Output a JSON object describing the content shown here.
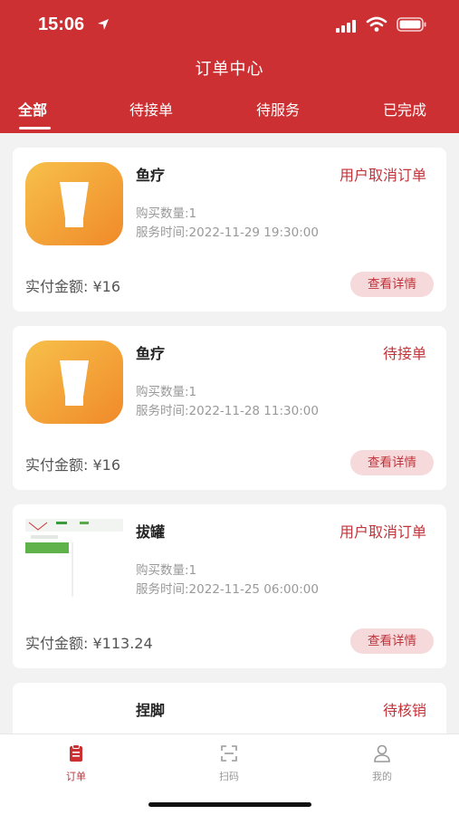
{
  "status_bar": {
    "time": "15:06"
  },
  "header": {
    "title": "订单中心"
  },
  "tabs": [
    {
      "label": "全部",
      "active": true
    },
    {
      "label": "待接单",
      "active": false
    },
    {
      "label": "待服务",
      "active": false
    },
    {
      "label": "已完成",
      "active": false
    }
  ],
  "orders": [
    {
      "name": "鱼疗",
      "status": "用户取消订单",
      "qty": "购买数量:1",
      "time": "服务时间:2022-11-29 19:30:00",
      "amount": "实付金额: ¥16",
      "detail_label": "查看详情",
      "thumb_icon": "lotion-tube-icon"
    },
    {
      "name": "鱼疗",
      "status": "待接单",
      "qty": "购买数量:1",
      "time": "服务时间:2022-11-28 11:30:00",
      "amount": "实付金额: ¥16",
      "detail_label": "查看详情",
      "thumb_icon": "lotion-tube-icon"
    },
    {
      "name": "拔罐",
      "status": "用户取消订单",
      "qty": "购买数量:1",
      "time": "服务时间:2022-11-25 06:00:00",
      "amount": "实付金额: ¥113.24",
      "detail_label": "查看详情",
      "thumb_icon": "webpage-thumbnail"
    },
    {
      "name": "捏脚",
      "status": "待核销",
      "thumb_icon": "webpage-thumbnail"
    }
  ],
  "tabbar": [
    {
      "label": "订单",
      "icon": "clipboard-icon",
      "active": true
    },
    {
      "label": "扫码",
      "icon": "scan-icon",
      "active": false
    },
    {
      "label": "我的",
      "icon": "user-icon",
      "active": false
    }
  ],
  "colors": {
    "primary": "#cc3033",
    "status": "#c0343a",
    "button_bg": "#f6d9db"
  }
}
